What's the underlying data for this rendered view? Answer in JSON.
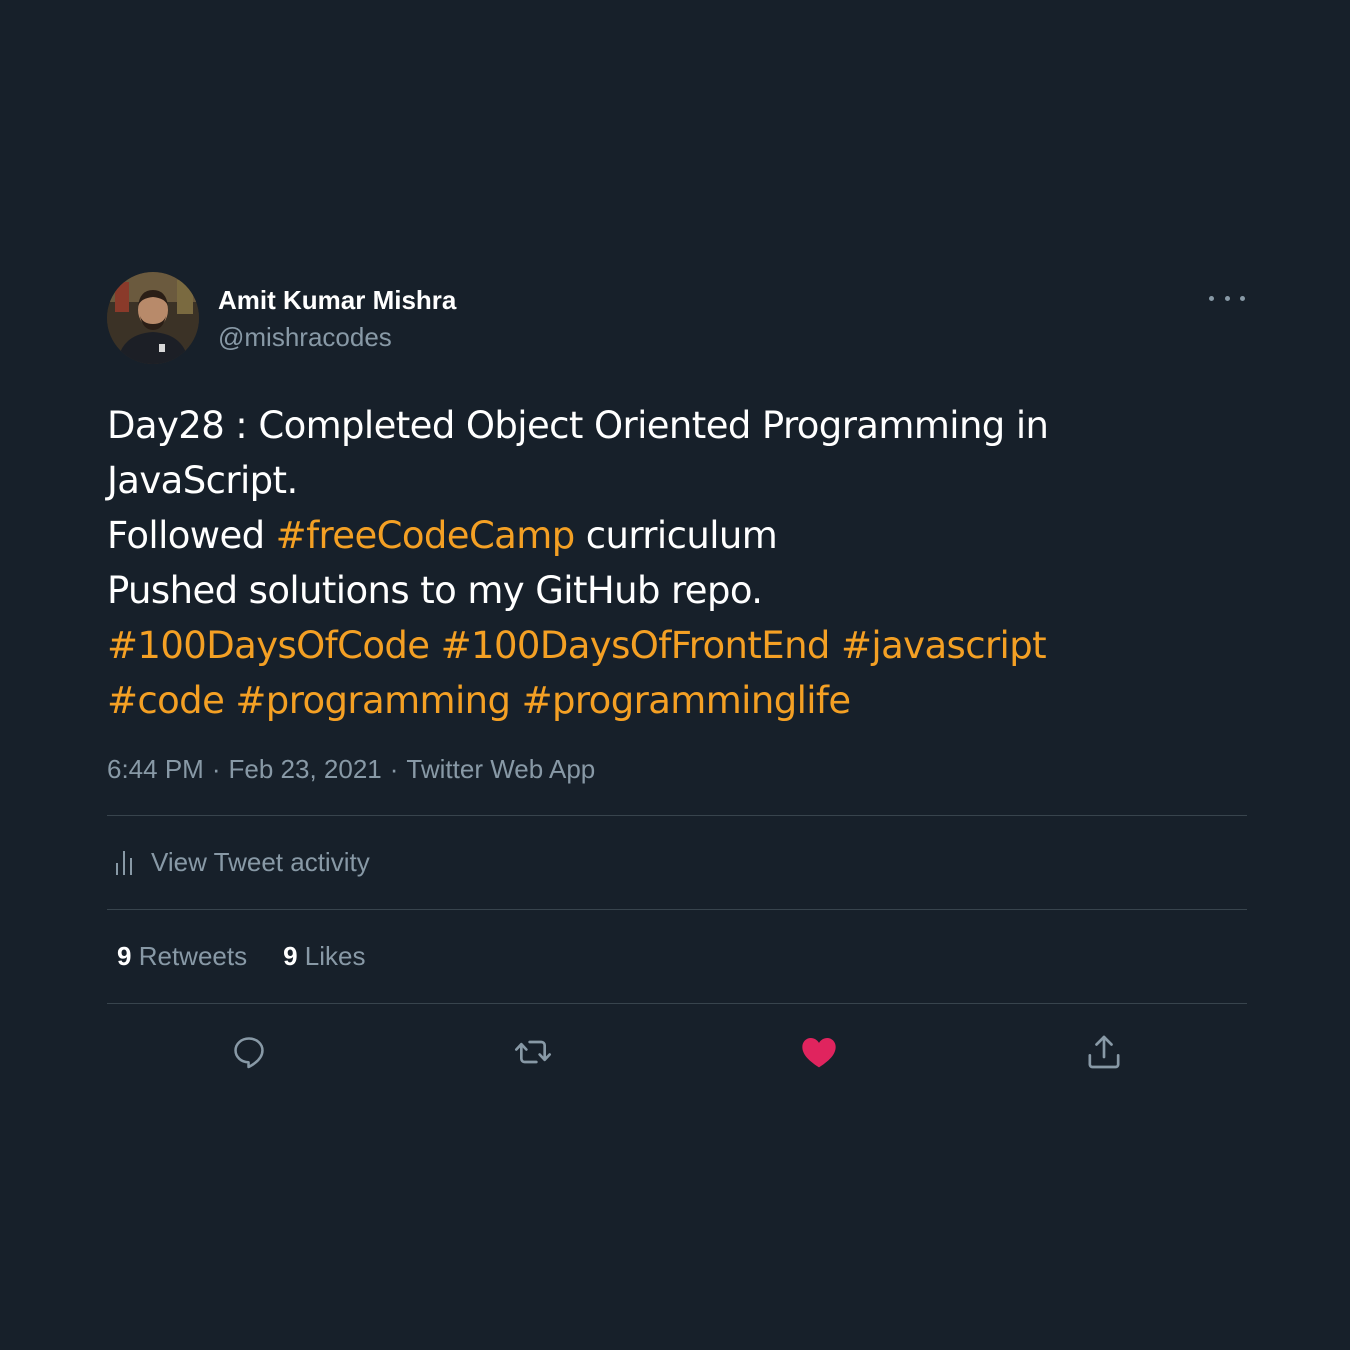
{
  "author": {
    "name": "Amit Kumar Mishra",
    "handle": "@mishracodes"
  },
  "tweet": {
    "lines": [
      [
        {
          "text": "Day28 : Completed Object Oriented Programming in",
          "hashtag": false
        }
      ],
      [
        {
          "text": "JavaScript.",
          "hashtag": false
        }
      ],
      [
        {
          "text": "Followed ",
          "hashtag": false
        },
        {
          "text": "#freeCodeCamp",
          "hashtag": true
        },
        {
          "text": " curriculum",
          "hashtag": false
        }
      ],
      [
        {
          "text": "Pushed solutions to my GitHub repo.",
          "hashtag": false
        }
      ],
      [
        {
          "text": "#100DaysOfCode",
          "hashtag": true
        },
        {
          "text": " ",
          "hashtag": false
        },
        {
          "text": "#100DaysOfFrontEnd",
          "hashtag": true
        },
        {
          "text": " ",
          "hashtag": false
        },
        {
          "text": "#javascript",
          "hashtag": true
        }
      ],
      [
        {
          "text": "#code",
          "hashtag": true
        },
        {
          "text": " ",
          "hashtag": false
        },
        {
          "text": "#programming",
          "hashtag": true
        },
        {
          "text": " ",
          "hashtag": false
        },
        {
          "text": "#programminglife",
          "hashtag": true
        }
      ]
    ],
    "time": "6:44 PM",
    "date": "Feb 23, 2021",
    "source": "Twitter Web App",
    "separator": "·"
  },
  "activity": {
    "label": "View Tweet activity",
    "icon": "analytics-icon"
  },
  "stats": {
    "retweets_count": "9",
    "retweets_label": "Retweets",
    "likes_count": "9",
    "likes_label": "Likes"
  },
  "actions": {
    "reply_icon": "reply-icon",
    "retweet_icon": "retweet-icon",
    "like_icon": "heart-icon",
    "share_icon": "share-icon"
  },
  "colors": {
    "background": "#17202a",
    "hashtag": "#f4a024",
    "muted": "#8899a6",
    "divider": "#38444d",
    "like": "#e0245e"
  }
}
